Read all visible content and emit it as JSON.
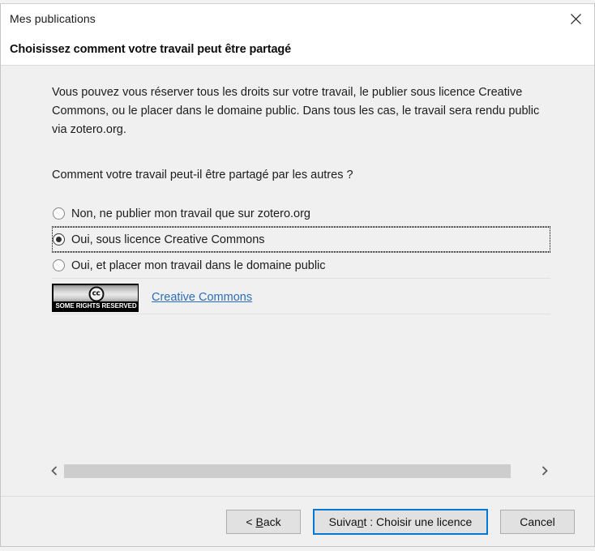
{
  "window": {
    "title": "Mes publications",
    "close_icon": "close-icon"
  },
  "header": {
    "title": "Choisissez comment votre travail peut être partagé"
  },
  "body": {
    "intro_paragraph": "Vous pouvez vous réserver tous les droits sur votre travail, le publier sous licence Creative Commons, ou le placer dans le domaine public. Dans tous les cas, le travail sera rendu public via zotero.org.",
    "question": "Comment votre travail peut-il être partagé par les autres ?",
    "options": [
      {
        "label": "Non, ne publier mon travail que sur zotero.org",
        "selected": false
      },
      {
        "label": "Oui, sous licence Creative Commons",
        "selected": true
      },
      {
        "label": "Oui, et placer mon travail dans le domaine public",
        "selected": false
      }
    ],
    "license_badge": {
      "logo_text": "cc",
      "caption": "SOME RIGHTS RESERVED"
    },
    "license_link": "Creative Commons"
  },
  "scrollbar": {
    "left_arrow_icon": "chevron-left-icon",
    "right_arrow_icon": "chevron-right-icon",
    "thumb_position": "0%",
    "thumb_width": "95%"
  },
  "footer": {
    "back_button": "< Back",
    "back_accesskey": "B",
    "next_button": "Suivant : Choisir une licence",
    "next_accesskey": "n",
    "cancel_button": "Cancel"
  },
  "colors": {
    "accent": "#0078d7",
    "link": "#2a6ebb",
    "dialog_bg": "#f0f0f0",
    "header_bg": "#ffffff"
  }
}
